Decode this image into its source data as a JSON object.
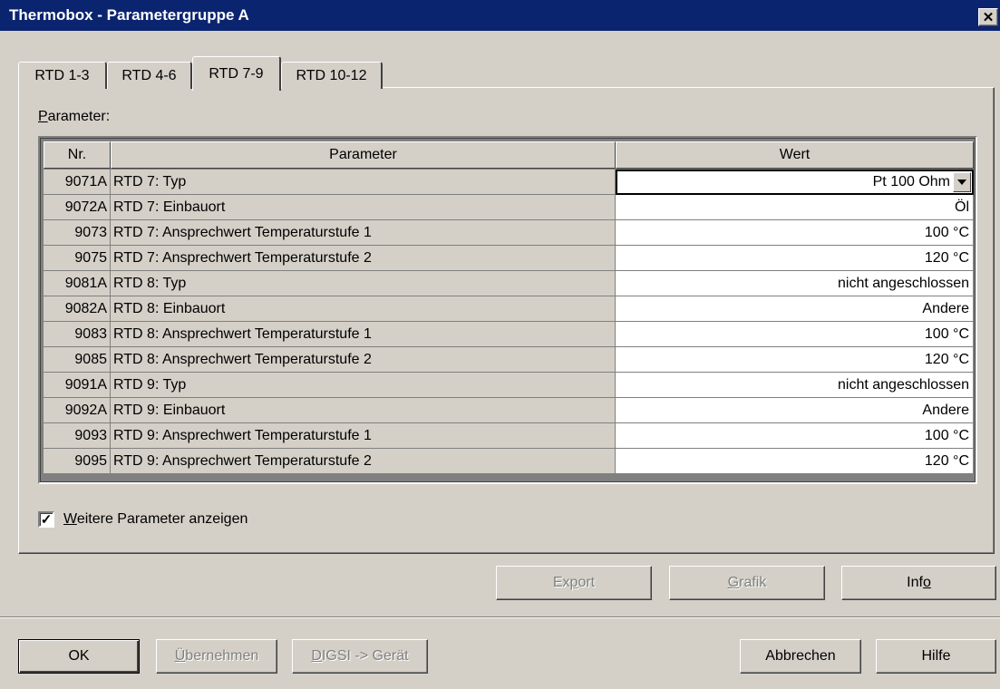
{
  "window": {
    "title": "Thermobox - Parametergruppe A",
    "close_label": "✕"
  },
  "tabs": [
    {
      "label": "RTD 1-3",
      "active": false
    },
    {
      "label": "RTD 4-6",
      "active": false
    },
    {
      "label": "RTD 7-9",
      "active": true
    },
    {
      "label": "RTD 10-12",
      "active": false
    }
  ],
  "section_label": {
    "first": "P",
    "rest": "arameter:"
  },
  "table": {
    "headers": {
      "nr": "Nr.",
      "parameter": "Parameter",
      "wert": "Wert"
    },
    "rows": [
      {
        "nr": "9071A",
        "parameter": "RTD 7: Typ",
        "wert": "Pt 100 Ohm"
      },
      {
        "nr": "9072A",
        "parameter": "RTD 7: Einbauort",
        "wert": "Öl"
      },
      {
        "nr": "9073",
        "parameter": "RTD 7: Ansprechwert Temperaturstufe 1",
        "wert": "100 °C"
      },
      {
        "nr": "9075",
        "parameter": "RTD 7: Ansprechwert Temperaturstufe 2",
        "wert": "120 °C"
      },
      {
        "nr": "9081A",
        "parameter": "RTD 8: Typ",
        "wert": "nicht angeschlossen"
      },
      {
        "nr": "9082A",
        "parameter": "RTD 8: Einbauort",
        "wert": "Andere"
      },
      {
        "nr": "9083",
        "parameter": "RTD 8: Ansprechwert Temperaturstufe 1",
        "wert": "100 °C"
      },
      {
        "nr": "9085",
        "parameter": "RTD 8: Ansprechwert Temperaturstufe 2",
        "wert": "120 °C"
      },
      {
        "nr": "9091A",
        "parameter": "RTD 9: Typ",
        "wert": "nicht angeschlossen"
      },
      {
        "nr": "9092A",
        "parameter": "RTD 9: Einbauort",
        "wert": "Andere"
      },
      {
        "nr": "9093",
        "parameter": "RTD 9: Ansprechwert Temperaturstufe 1",
        "wert": "100 °C"
      },
      {
        "nr": "9095",
        "parameter": "RTD 9: Ansprechwert Temperaturstufe 2",
        "wert": "120 °C"
      }
    ]
  },
  "checkbox": {
    "checked": true,
    "mark": "✓",
    "first": "W",
    "rest": "eitere Parameter anzeigen"
  },
  "buttons": {
    "export": {
      "pre": "Ex",
      "u": "p",
      "post": "ort",
      "enabled": false
    },
    "grafik": {
      "pre": "",
      "u": "G",
      "post": "rafik",
      "enabled": false
    },
    "info": {
      "pre": "Inf",
      "u": "o",
      "post": "",
      "enabled": true
    },
    "ok": {
      "label": "OK",
      "enabled": true
    },
    "uebernehmen": {
      "pre": "",
      "u": "Ü",
      "post": "bernehmen",
      "enabled": false
    },
    "digsi": {
      "pre": "",
      "u": "D",
      "post": "IGSI -> Gerät",
      "enabled": false
    },
    "abbrechen": {
      "label": "Abbrechen",
      "enabled": true
    },
    "hilfe": {
      "label": "Hilfe",
      "enabled": true
    }
  }
}
